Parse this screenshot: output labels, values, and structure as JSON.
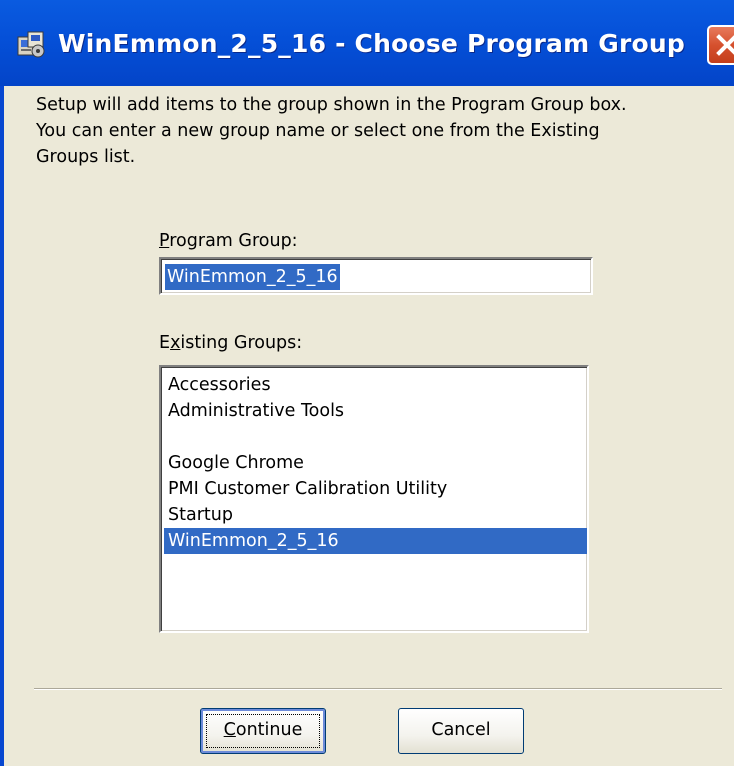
{
  "window": {
    "title": "WinEmmon_2_5_16 - Choose Program Group",
    "icon": "setup-icon",
    "close_icon": "close-icon"
  },
  "description": {
    "line1": "Setup will add items to the group shown in the Program Group box.",
    "line2": "You can enter a new group name or select one from the Existing",
    "line3": "Groups list."
  },
  "program_group": {
    "label_accel": "P",
    "label_rest": "rogram Group:",
    "value": "WinEmmon_2_5_16"
  },
  "existing_groups": {
    "label_pre": "E",
    "label_accel": "x",
    "label_rest": "isting Groups:",
    "items": [
      "Accessories",
      "Administrative Tools",
      "",
      "Google Chrome",
      "PMI Customer Calibration Utility",
      "Startup",
      "WinEmmon_2_5_16"
    ],
    "selected": "WinEmmon_2_5_16"
  },
  "buttons": {
    "continue_accel": "C",
    "continue_rest": "ontinue",
    "cancel": "Cancel"
  },
  "colors": {
    "titlebar": "#0550d8",
    "dialog_bg": "#ece9d8",
    "selection": "#316ac5",
    "close_button": "#d6512e"
  }
}
